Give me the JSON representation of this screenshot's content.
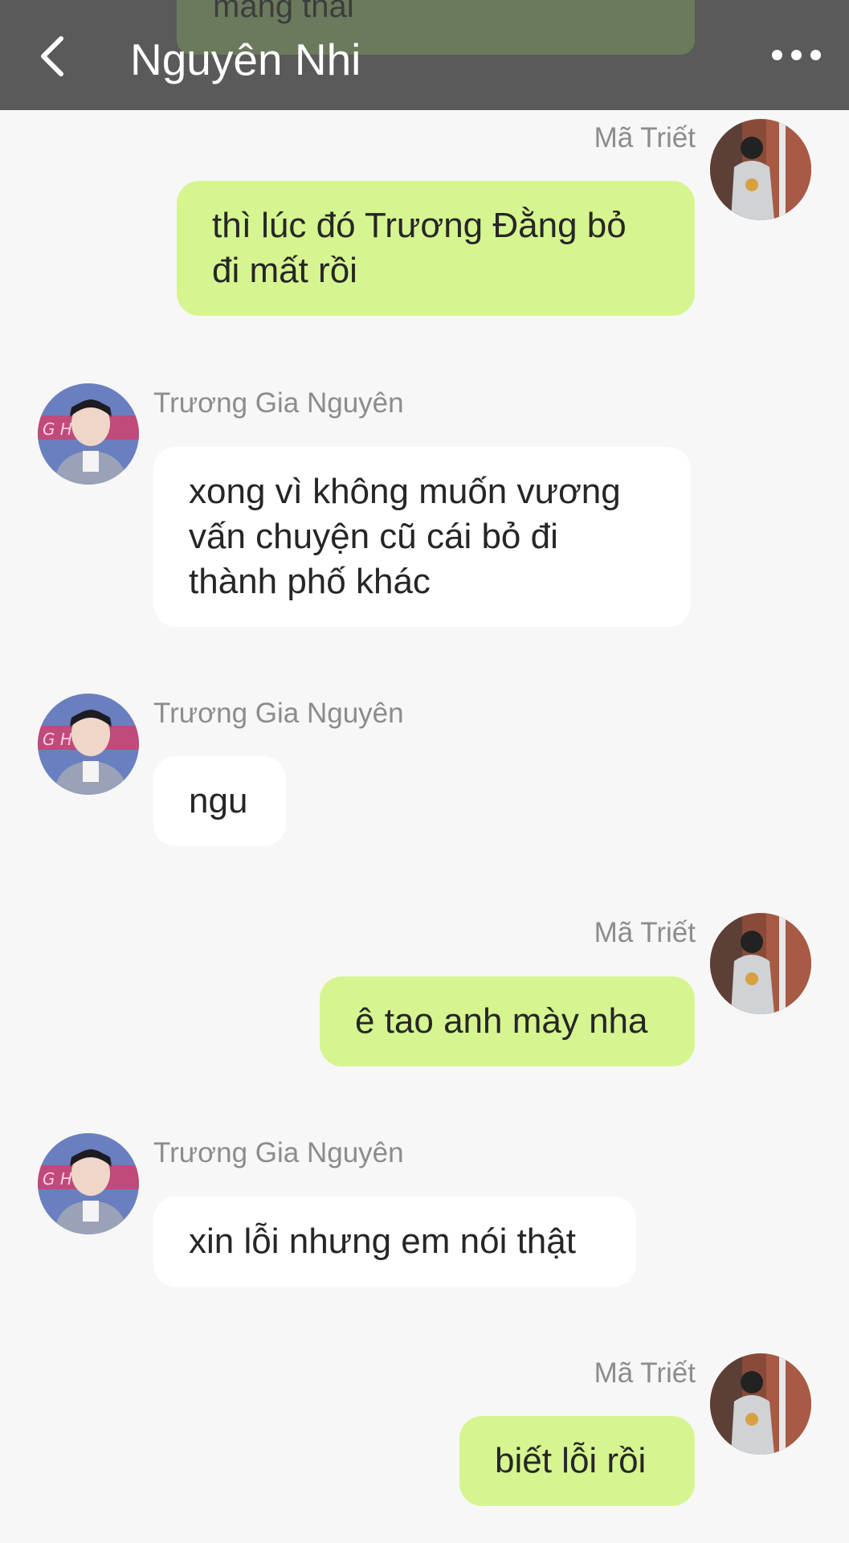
{
  "header": {
    "title": "Nguyên Nhi",
    "previous_message_peek": "mang thai"
  },
  "participants": {
    "me": "Mã Triết",
    "other": "Trương Gia Nguyên"
  },
  "messages": [
    {
      "sender": "Mã Triết",
      "direction": "out",
      "text": "thì lúc đó Trương Đằng bỏ đi mất rồi"
    },
    {
      "sender": "Trương Gia Nguyên",
      "direction": "in",
      "text": "xong vì không muốn vương vấn chuyện cũ cái bỏ đi thành phố khác"
    },
    {
      "sender": "Trương Gia Nguyên",
      "direction": "in",
      "text": "ngu"
    },
    {
      "sender": "Mã Triết",
      "direction": "out",
      "text": "ê tao anh mày nha"
    },
    {
      "sender": "Trương Gia Nguyên",
      "direction": "in",
      "text": "xin lỗi nhưng em nói thật"
    },
    {
      "sender": "Mã Triết",
      "direction": "out",
      "text": "biết lỗi rồi"
    }
  ],
  "colors": {
    "header_bg": "#5a5a5a",
    "outgoing_bubble": "#d6f590",
    "incoming_bubble": "#ffffff",
    "background": "#f7f7f7"
  },
  "icons": {
    "back": "chevron-left-icon",
    "more": "more-horizontal-icon"
  }
}
